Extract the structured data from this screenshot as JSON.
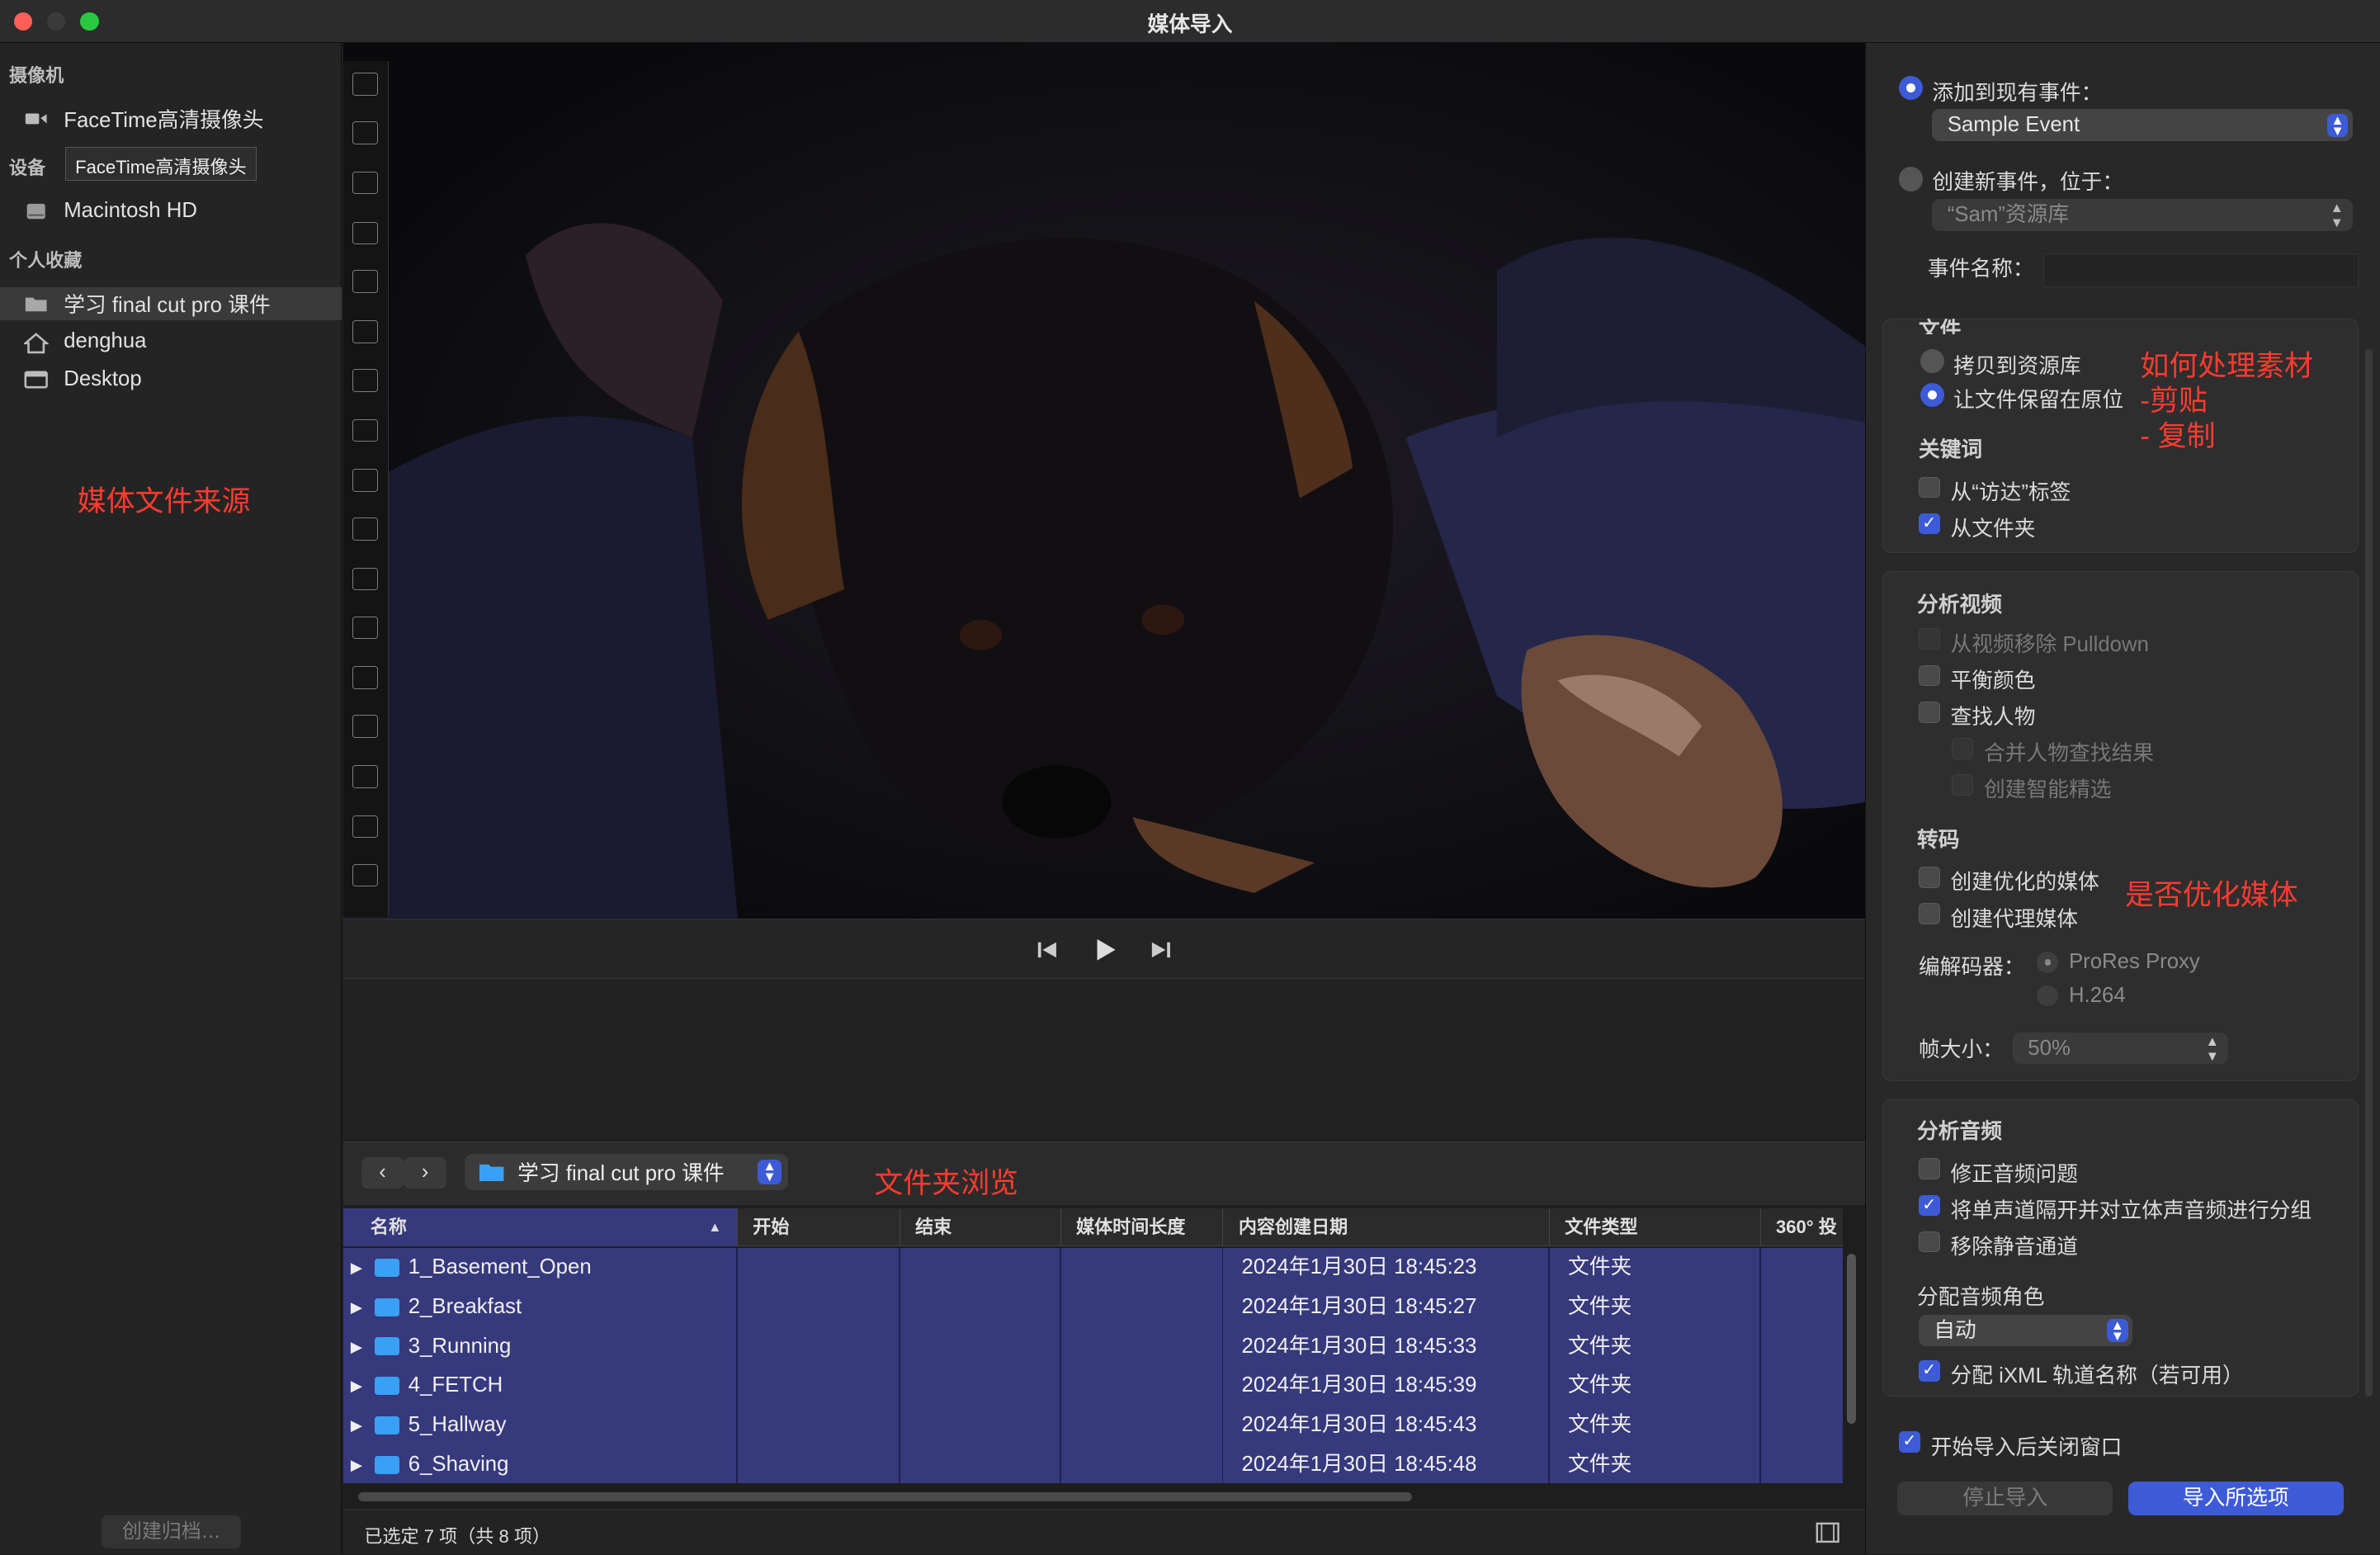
{
  "window": {
    "title": "媒体导入"
  },
  "sidebar": {
    "cameras_header": "摄像机",
    "camera_item": "FaceTime高清摄像头",
    "devices_header": "设备",
    "device_tooltip": "FaceTime高清摄像头",
    "device_item": "Macintosh HD",
    "favorites_header": "个人收藏",
    "favorites": [
      "学习 final cut pro 课件",
      "denghua",
      "Desktop"
    ],
    "annotation": "媒体文件来源",
    "archive_button": "创建归档…"
  },
  "browser": {
    "folder": "学习 final cut pro 课件",
    "annotation": "文件夹浏览",
    "columns": [
      "名称",
      "开始",
      "结束",
      "媒体时间长度",
      "内容创建日期",
      "文件类型",
      "360° 投"
    ],
    "rows": [
      {
        "name": "1_Basement_Open",
        "date": "2024年1月30日 18:45:23",
        "type": "文件夹"
      },
      {
        "name": "2_Breakfast",
        "date": "2024年1月30日 18:45:27",
        "type": "文件夹"
      },
      {
        "name": "3_Running",
        "date": "2024年1月30日 18:45:33",
        "type": "文件夹"
      },
      {
        "name": "4_FETCH",
        "date": "2024年1月30日 18:45:39",
        "type": "文件夹"
      },
      {
        "name": "5_Hallway",
        "date": "2024年1月30日 18:45:43",
        "type": "文件夹"
      },
      {
        "name": "6_Shaving",
        "date": "2024年1月30日 18:45:48",
        "type": "文件夹"
      }
    ],
    "status": "已选定 7 项（共 8 项）"
  },
  "import": {
    "add_existing_label": "添加到现有事件：",
    "existing_event": "Sample Event",
    "create_new_label": "创建新事件，位于：",
    "library": "“Sam”资源库",
    "event_name_label": "事件名称：",
    "files_header": "文件",
    "copy_to_library": "拷贝到资源库",
    "leave_in_place": "让文件保留在原位",
    "annotation_files": [
      "如何处理素材",
      "-剪贴",
      "- 复制"
    ],
    "keywords_header": "关键词",
    "from_finder_tags": "从“访达”标签",
    "from_folders": "从文件夹",
    "analyze_video_header": "分析视频",
    "remove_pulldown": "从视频移除 Pulldown",
    "balance_color": "平衡颜色",
    "find_people": "查找人物",
    "consolidate_people": "合并人物查找结果",
    "create_smart": "创建智能精选",
    "transcode_header": "转码",
    "create_optimized": "创建优化的媒体",
    "create_proxy": "创建代理媒体",
    "annotation_optimize": "是否优化媒体",
    "codec_label": "编解码器：",
    "codec_prores": "ProRes Proxy",
    "codec_h264": "H.264",
    "frame_size_label": "帧大小：",
    "frame_size": "50%",
    "analyze_audio_header": "分析音频",
    "fix_audio": "修正音频问题",
    "separate_mono": "将单声道隔开并对立体声音频进行分组",
    "remove_silent": "移除静音通道",
    "assign_roles_header": "分配音频角色",
    "role": "自动",
    "assign_ixml": "分配 iXML 轨道名称（若可用）",
    "close_after": "开始导入后关闭窗口",
    "stop_button": "停止导入",
    "import_button": "导入所选项"
  },
  "colors": {
    "accent": "#3d5bd6",
    "selection": "#36397c",
    "annotation": "#ff3b30",
    "folder": "#39a0f5"
  },
  "icons": [
    "camera-icon",
    "drive-icon",
    "folder-icon",
    "home-icon",
    "desktop-icon",
    "skip-back-icon",
    "play-icon",
    "skip-forward-icon",
    "filmstrip-icon"
  ]
}
